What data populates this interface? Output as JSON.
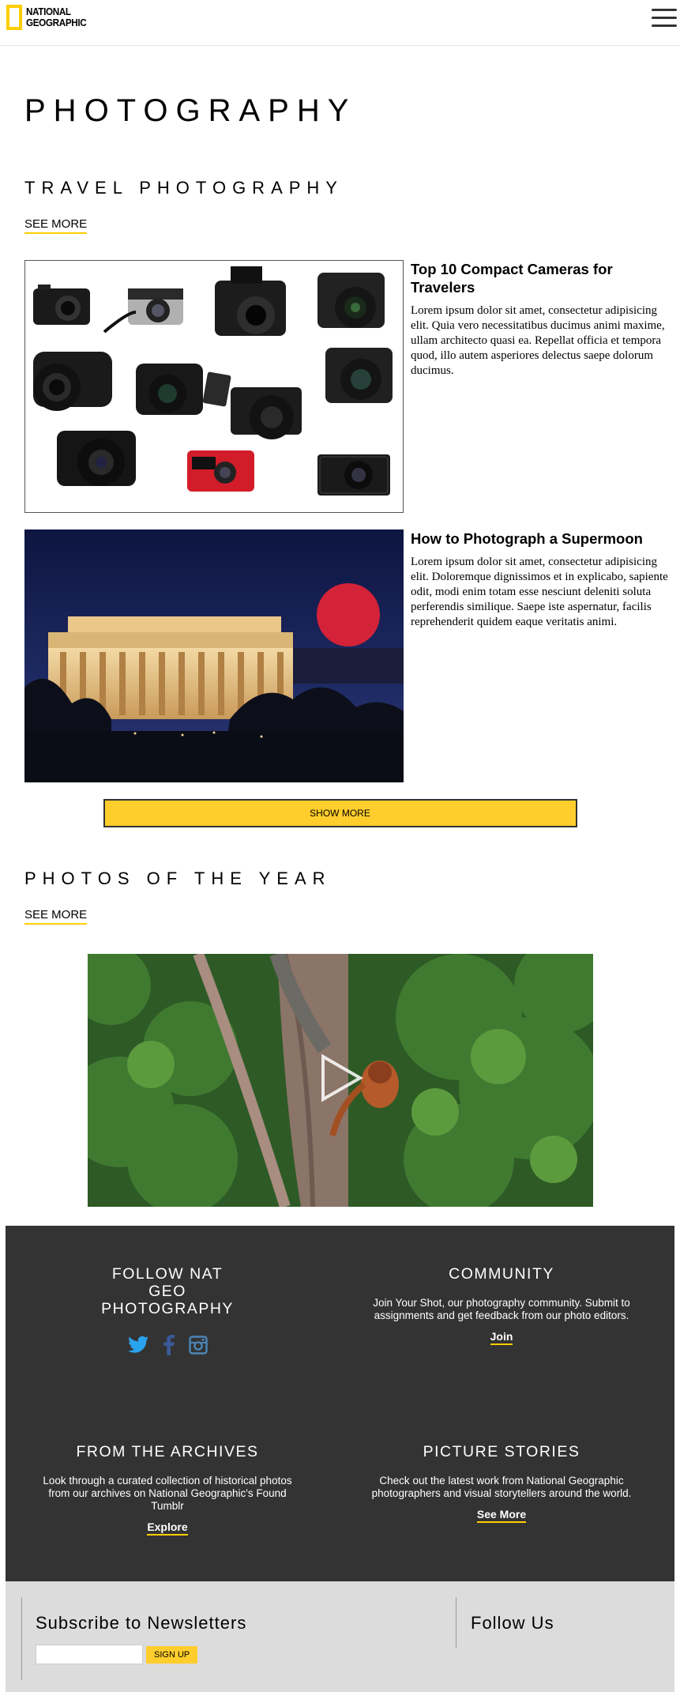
{
  "header": {
    "logo_line1": "NATIONAL",
    "logo_line2": "GEOGRAPHIC",
    "accent_color": "#ffce00"
  },
  "page_title": "PHOTOGRAPHY",
  "travel": {
    "heading": "TRAVEL PHOTOGRAPHY",
    "see_more": "SEE MORE",
    "articles": [
      {
        "title": "Top 10 Compact Cameras for Travelers",
        "body": "Lorem ipsum dolor sit amet, consectetur adipisicing elit. Quia vero necessitatibus ducimus animi maxime, ullam architecto quasi ea. Repellat officia et tempora quod, illo autem asperiores delectus saepe dolorum ducimus."
      },
      {
        "title": "How to Photograph a Supermoon",
        "body": "Lorem ipsum dolor sit amet, consectetur adipisicing elit. Doloremque dignissimos et in explicabo, sapiente odit, modi enim totam esse nesciunt deleniti soluta perferendis similique. Saepe iste aspernatur, facilis reprehenderit quidem eaque veritatis animi."
      }
    ],
    "show_more": "SHOW MORE"
  },
  "photos_of_year": {
    "heading": "PHOTOS OF THE YEAR",
    "see_more": "SEE MORE"
  },
  "footer": {
    "follow_title": "FOLLOW NAT GEO PHOTOGRAPHY",
    "social_icons": [
      "twitter-icon",
      "facebook-icon",
      "instagram-icon"
    ],
    "community_title": "COMMUNITY",
    "community_text": "Join Your Shot, our photography community. Submit to assignments and get feedback from our photo editors.",
    "community_link": "Join",
    "archives_title": "FROM THE ARCHIVES",
    "archives_text": "Look through a curated collection of historical photos from our archives on National Geographic's Found Tumblr",
    "archives_link": "Explore",
    "stories_title": "PICTURE STORIES",
    "stories_text": "Check out the latest work from National Geographic photographers and visual storytellers around the world.",
    "stories_link": "See More"
  },
  "newsletter": {
    "title": "Subscribe to Newsletters",
    "input_value": "",
    "button": "SIGN UP",
    "follow_title": "Follow Us"
  }
}
